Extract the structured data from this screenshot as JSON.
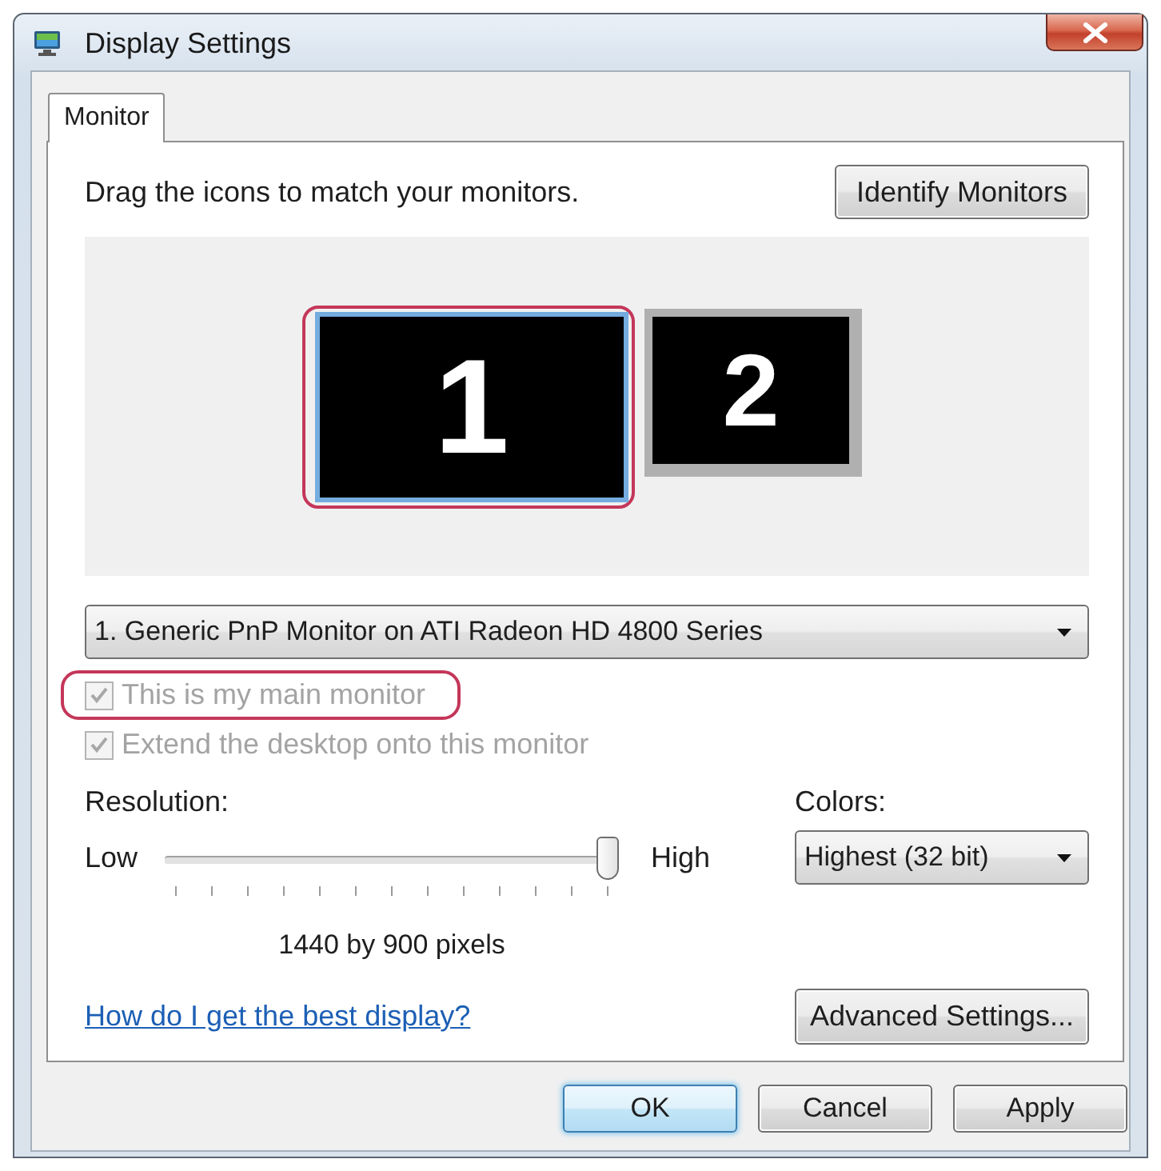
{
  "window": {
    "title": "Display Settings"
  },
  "tabs": [
    {
      "label": "Monitor",
      "selected": true
    }
  ],
  "instructions": "Drag the icons to match your monitors.",
  "identify_button": "Identify Monitors",
  "monitors": [
    {
      "label": "1",
      "selected": true,
      "highlighted": true
    },
    {
      "label": "2",
      "selected": false,
      "highlighted": false
    }
  ],
  "monitor_select": {
    "value": "1. Generic PnP Monitor on ATI Radeon HD 4800 Series"
  },
  "checkboxes": [
    {
      "label": "This is my main monitor",
      "checked": true,
      "disabled": true,
      "highlighted": true
    },
    {
      "label": "Extend the desktop onto this monitor",
      "checked": true,
      "disabled": true,
      "highlighted": false
    }
  ],
  "resolution": {
    "label": "Resolution:",
    "min_label": "Low",
    "max_label": "High",
    "level": 1,
    "reading": "1440 by 900 pixels"
  },
  "colors": {
    "label": "Colors:",
    "value": "Highest (32 bit)"
  },
  "help_link": "How do I get the best display?",
  "advanced_button": "Advanced Settings...",
  "buttons": [
    {
      "label": "OK",
      "default": true
    },
    {
      "label": "Cancel",
      "default": false
    },
    {
      "label": "Apply",
      "default": false
    }
  ]
}
